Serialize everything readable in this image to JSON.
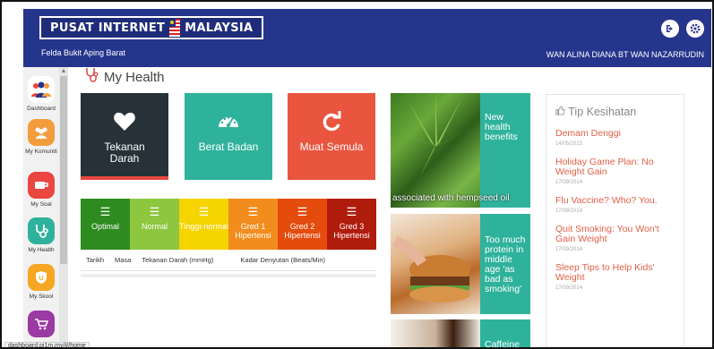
{
  "header": {
    "logo_text_left": "PUSAT INTERNET",
    "logo_text_right": "MALAYSIA",
    "location": "Felda Bukit Aping Barat",
    "user_name": "WAN ALINA DIANA BT WAN NAZARRUDIN"
  },
  "sidebar": {
    "items": [
      {
        "label": "Dashboard",
        "color": "#ffffff",
        "icon": "people-group-icon"
      },
      {
        "label": "My Komuniti",
        "color": "#f39c3c",
        "icon": "community-icon"
      },
      {
        "label": "My Soal",
        "color": "#e9463f",
        "icon": "question-icon"
      },
      {
        "label": "My Health",
        "color": "#2fb29c",
        "icon": "stethoscope-icon"
      },
      {
        "label": "My Skool",
        "color": "#f5a623",
        "icon": "shield-icon"
      },
      {
        "label": "",
        "color": "#9b3aa3",
        "icon": "cart-icon"
      }
    ]
  },
  "page": {
    "title": "My Health"
  },
  "tiles": [
    {
      "label": "Tekanan Darah",
      "color": "#263238",
      "icon": "heart-icon"
    },
    {
      "label": "Berat Badan",
      "color": "#2fb29c",
      "icon": "gauge-icon"
    },
    {
      "label": "Muat Semula",
      "color": "#e9553f",
      "icon": "refresh-icon"
    }
  ],
  "legend": {
    "categories": [
      {
        "label": "Optimal",
        "color": "#2e8b20"
      },
      {
        "label": "Normal",
        "color": "#8dc63f"
      },
      {
        "label": "Tinggi-normal",
        "color": "#f6d400"
      },
      {
        "label": "Gred 1 Hipertensi",
        "color": "#f28c1c"
      },
      {
        "label": "Gred 2 Hipertensi",
        "color": "#e44b0c"
      },
      {
        "label": "Gred 3 Hipertensi",
        "color": "#b01c0c"
      }
    ],
    "columns": [
      "Tarikh",
      "Masa",
      "Tekanan Darah (mmHg)",
      "Kadar Denyutan (Beats/Min)"
    ]
  },
  "news": [
    {
      "text": "New health benefits",
      "caption": "associated with hempseed oil"
    },
    {
      "text": "Too much protein in middle age 'as bad as smoking'"
    },
    {
      "text": "Caffeine"
    }
  ],
  "tips": {
    "heading": "Tip Kesihatan",
    "items": [
      {
        "title": "Demam Denggi",
        "date": "14/05/2015"
      },
      {
        "title": "Holiday Game Plan: No Weight Gain",
        "date": "17/09/2014"
      },
      {
        "title": "Flu Vaccine? Who? You.",
        "date": "17/09/2014"
      },
      {
        "title": "Quit Smoking: You Won't Gain Weight",
        "date": "17/09/2014"
      },
      {
        "title": "Sleep Tips to Help Kids' Weight",
        "date": "17/09/2014"
      }
    ]
  },
  "status_bar": "dashboard.pi1m.my/#/home"
}
